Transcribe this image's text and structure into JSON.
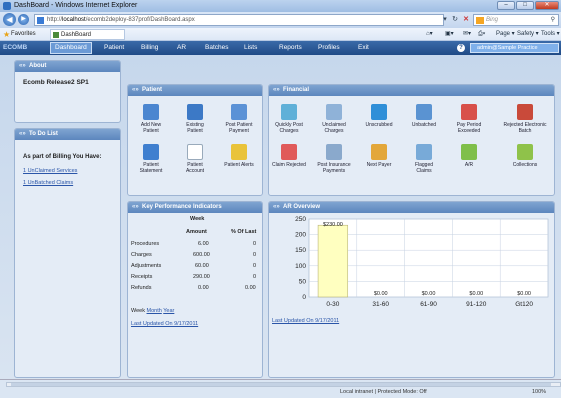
{
  "window": {
    "title": "DashBoard - Windows Internet Explorer"
  },
  "address": {
    "url_prefix": "http://",
    "url_host": "localhost",
    "url_path": "/ecomb2deploy-837prof/DashBoard.aspx",
    "search_placeholder": "Bing"
  },
  "favorites": {
    "label": "Favorites",
    "tab": "DashBoard",
    "page": "Page ▾",
    "safety": "Safety ▾",
    "tools": "Tools ▾"
  },
  "nav": {
    "brand": "ECOMB",
    "items": [
      "Dashboard",
      "Patient",
      "Billing",
      "AR",
      "Batches",
      "Lists",
      "Reports",
      "Profiles",
      "Exit"
    ],
    "user": "admin@Sample Practice"
  },
  "about": {
    "header": "About",
    "text": "Ecomb Release2 SP1"
  },
  "todo": {
    "header": "To Do List",
    "title": "As part of Billing You Have:",
    "links": [
      "1 UnClaimed Services",
      "1 UnBatched Claims"
    ]
  },
  "patient": {
    "header": "Patient",
    "tiles": [
      "Add New Patient",
      "Existing Patient",
      "Post Patient Payment",
      "Patient Statement",
      "Patient Account",
      "Patient Alerts"
    ]
  },
  "financial": {
    "header": "Financial",
    "tiles": [
      "Quickly Post Charges",
      "Unclaimed Charges",
      "Unscrubbed",
      "Unbatched",
      "Pay Period Exceeded",
      "Rejected Electronic Batch",
      "Claim Rejected",
      "Post Insurance Payments",
      "Next Payer",
      "Flagged Claims",
      "A/R",
      "Collections"
    ]
  },
  "kpi": {
    "header": "Key Performance Indicators",
    "period": "Week",
    "col_amount": "Amount",
    "col_pct": "% Of Last",
    "rows": [
      {
        "label": "Procedures",
        "amount": "6.00",
        "pct": "0"
      },
      {
        "label": "Charges",
        "amount": "600.00",
        "pct": "0"
      },
      {
        "label": "Adjustments",
        "amount": "60.00",
        "pct": "0"
      },
      {
        "label": "Receipts",
        "amount": "290.00",
        "pct": "0"
      },
      {
        "label": "Refunds",
        "amount": "0.00",
        "pct": "0.00"
      }
    ],
    "period_links": [
      "Week",
      "Month",
      "Year"
    ],
    "updated": "Last Updated On 9/17/2011"
  },
  "ar": {
    "header": "AR Overview",
    "updated": "Last Updated On 9/17/2011"
  },
  "chart_data": {
    "type": "bar",
    "categories": [
      "0-30",
      "31-60",
      "61-90",
      "91-120",
      "Gt120"
    ],
    "values": [
      230,
      0,
      0,
      0,
      0
    ],
    "data_labels": [
      "$230.00",
      "$0.00",
      "$0.00",
      "$0.00",
      "$0.00"
    ],
    "ylim": [
      0,
      250
    ],
    "yticks": [
      0,
      50,
      100,
      150,
      200,
      250
    ],
    "grid": true,
    "bar_color": "#ffffc0"
  },
  "status": {
    "text": "Local intranet | Protected Mode: Off",
    "zoom": "100%"
  }
}
